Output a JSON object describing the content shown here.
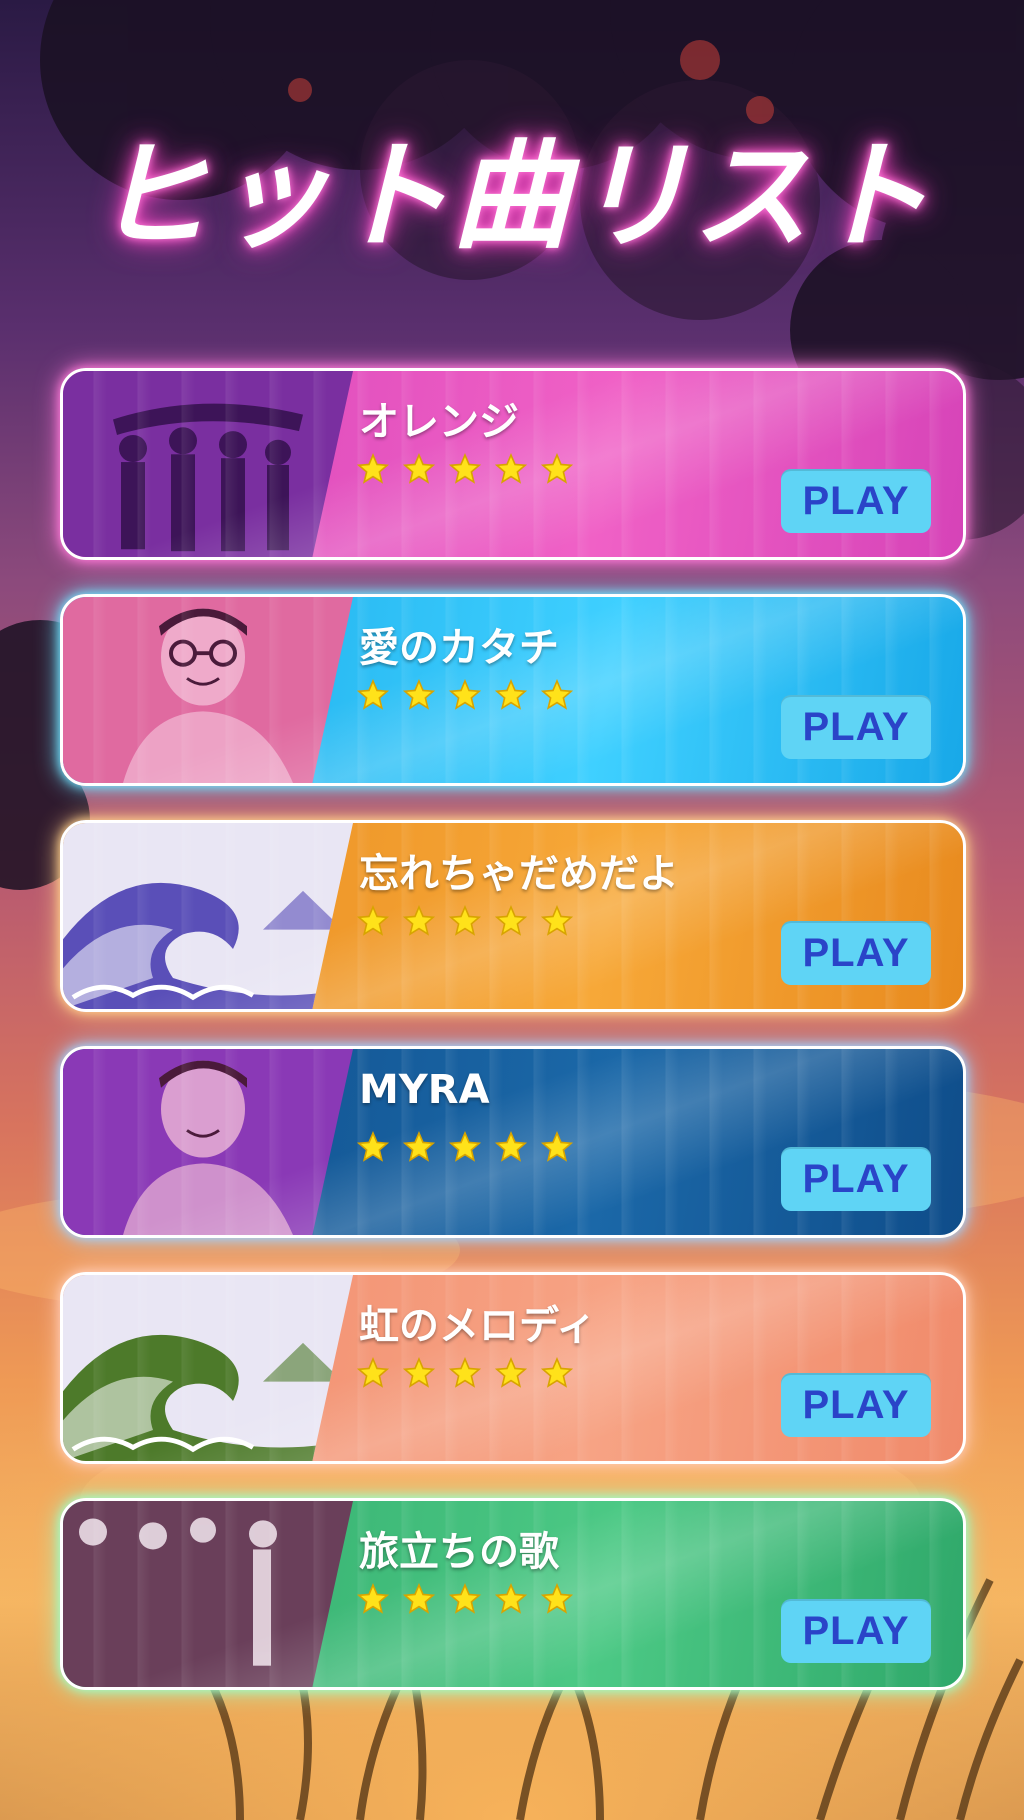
{
  "screen": {
    "title": "ヒット曲リスト"
  },
  "songs": [
    {
      "name": "オレンジ",
      "rating": 5,
      "play_label": "PLAY",
      "card_color": "#d643b8",
      "card_color_2": "#f061c6",
      "glow": "#ff7ad9",
      "thumb_color": "#7a2fa0",
      "thumb_art": "group-silhouette"
    },
    {
      "name": "愛のカタチ",
      "rating": 5,
      "play_label": "PLAY",
      "card_color": "#18a8e8",
      "card_color_2": "#3fd0ff",
      "glow": "#6fe3ff",
      "thumb_color": "#e06aa0",
      "thumb_art": "portrait-man-glasses"
    },
    {
      "name": "忘れちゃだめだよ",
      "rating": 5,
      "play_label": "PLAY",
      "card_color": "#e88a1e",
      "card_color_2": "#f7a838",
      "glow": "#ffd08a",
      "thumb_color": "#5a4fb8",
      "thumb_art": "great-wave"
    },
    {
      "name": "MYRA",
      "rating": 5,
      "play_label": "PLAY",
      "card_color": "#0f4d8a",
      "card_color_2": "#1b68a8",
      "glow": "#9fd2ff",
      "thumb_color": "#8a39b6",
      "thumb_art": "portrait-man"
    },
    {
      "name": "虹のメロディ",
      "rating": 5,
      "play_label": "PLAY",
      "card_color": "#f08a6a",
      "card_color_2": "#f7a384",
      "glow": "#ffc9b0",
      "thumb_color": "#4d7a2a",
      "thumb_art": "great-wave"
    },
    {
      "name": "旅立ちの歌",
      "rating": 5,
      "play_label": "PLAY",
      "card_color": "#2fa86a",
      "card_color_2": "#4cc985",
      "glow": "#9dffc8",
      "thumb_color": "#6a3f5a",
      "thumb_art": "band-photo"
    }
  ]
}
